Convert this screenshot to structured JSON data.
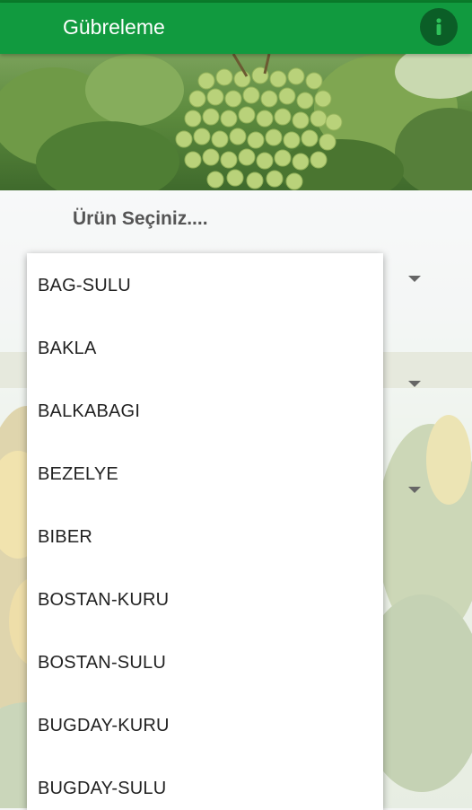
{
  "header": {
    "title": "Gübreleme"
  },
  "form": {
    "prompt": "Ürün Seçiniz...."
  },
  "dropdown": {
    "options": [
      "BAG-SULU",
      "BAKLA",
      "BALKABAGI",
      "BEZELYE",
      "BIBER",
      "BOSTAN-KURU",
      "BOSTAN-SULU",
      "BUGDAY-KURU",
      "BUGDAY-SULU"
    ]
  },
  "colors": {
    "appbar": "#119a3f",
    "info_button": "#0b5e27"
  },
  "icons": {
    "info": "info-icon",
    "dropdown_arrow": "chevron-down-icon"
  }
}
